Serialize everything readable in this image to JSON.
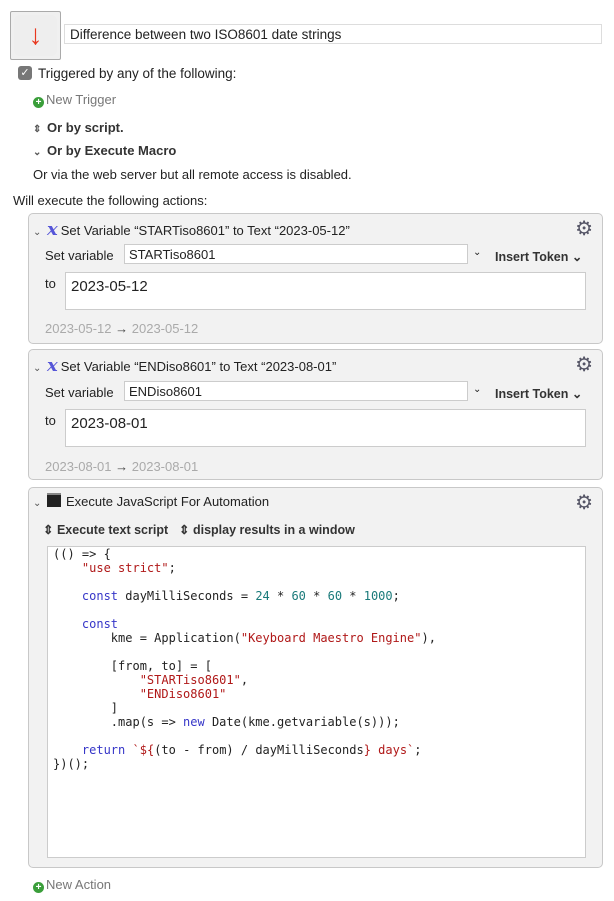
{
  "macro": {
    "title": "Difference between two ISO8601 date strings",
    "icon": "arrow-down-icon",
    "icon_color": "#e8381f"
  },
  "triggers": {
    "label": "Triggered by any of the following:",
    "checked": true,
    "new_trigger": "New Trigger",
    "by_script": "Or by script.",
    "by_execute_macro": "Or by Execute Macro",
    "web_server": "Or via the web server but all remote access is disabled."
  },
  "actions_label": "Will execute the following actions:",
  "actions": [
    {
      "title": "Set Variable “STARTiso8601” to Text “2023-05-12”",
      "set_label": "Set variable",
      "variable": "STARTiso8601",
      "insert_token": "Insert Token",
      "to_label": "to",
      "text": "2023-05-12",
      "result_from": "2023-05-12",
      "result_arrow": "→",
      "result_to": "2023-05-12"
    },
    {
      "title": "Set Variable “ENDiso8601” to Text “2023-08-01”",
      "set_label": "Set variable",
      "variable": "ENDiso8601",
      "insert_token": "Insert Token",
      "to_label": "to",
      "text": "2023-08-01",
      "result_from": "2023-08-01",
      "result_arrow": "→",
      "result_to": "2023-08-01"
    },
    {
      "title": "Execute JavaScript For Automation",
      "mode": "Execute text script",
      "output": "display results in a window",
      "code": [
        [
          [
            "p",
            "(() => {"
          ]
        ],
        [
          [
            "p",
            "    "
          ],
          [
            "s",
            "\"use strict\""
          ],
          [
            "p",
            ";"
          ]
        ],
        [
          [
            "p",
            ""
          ]
        ],
        [
          [
            "p",
            "    "
          ],
          [
            "k",
            "const"
          ],
          [
            "p",
            " dayMilliSeconds = "
          ],
          [
            "n",
            "24"
          ],
          [
            "p",
            " * "
          ],
          [
            "n",
            "60"
          ],
          [
            "p",
            " * "
          ],
          [
            "n",
            "60"
          ],
          [
            "p",
            " * "
          ],
          [
            "n",
            "1000"
          ],
          [
            "p",
            ";"
          ]
        ],
        [
          [
            "p",
            ""
          ]
        ],
        [
          [
            "p",
            "    "
          ],
          [
            "k",
            "const"
          ]
        ],
        [
          [
            "p",
            "        kme = Application("
          ],
          [
            "s",
            "\"Keyboard Maestro Engine\""
          ],
          [
            "p",
            "),"
          ]
        ],
        [
          [
            "p",
            ""
          ]
        ],
        [
          [
            "p",
            "        [from, to] = ["
          ]
        ],
        [
          [
            "p",
            "            "
          ],
          [
            "s",
            "\"STARTiso8601\""
          ],
          [
            "p",
            ","
          ]
        ],
        [
          [
            "p",
            "            "
          ],
          [
            "s",
            "\"ENDiso8601\""
          ]
        ],
        [
          [
            "p",
            "        ]"
          ]
        ],
        [
          [
            "p",
            "        .map(s => "
          ],
          [
            "k",
            "new"
          ],
          [
            "p",
            " Date(kme.getvariable(s)));"
          ]
        ],
        [
          [
            "p",
            ""
          ]
        ],
        [
          [
            "p",
            "    "
          ],
          [
            "k",
            "return"
          ],
          [
            "p",
            " "
          ],
          [
            "s",
            "`${"
          ],
          [
            "p",
            "(to - from) / dayMilliSeconds"
          ],
          [
            "s",
            "} days`"
          ],
          [
            "p",
            ";"
          ]
        ],
        [
          [
            "p",
            "})();"
          ]
        ]
      ]
    }
  ],
  "new_action": "New Action"
}
